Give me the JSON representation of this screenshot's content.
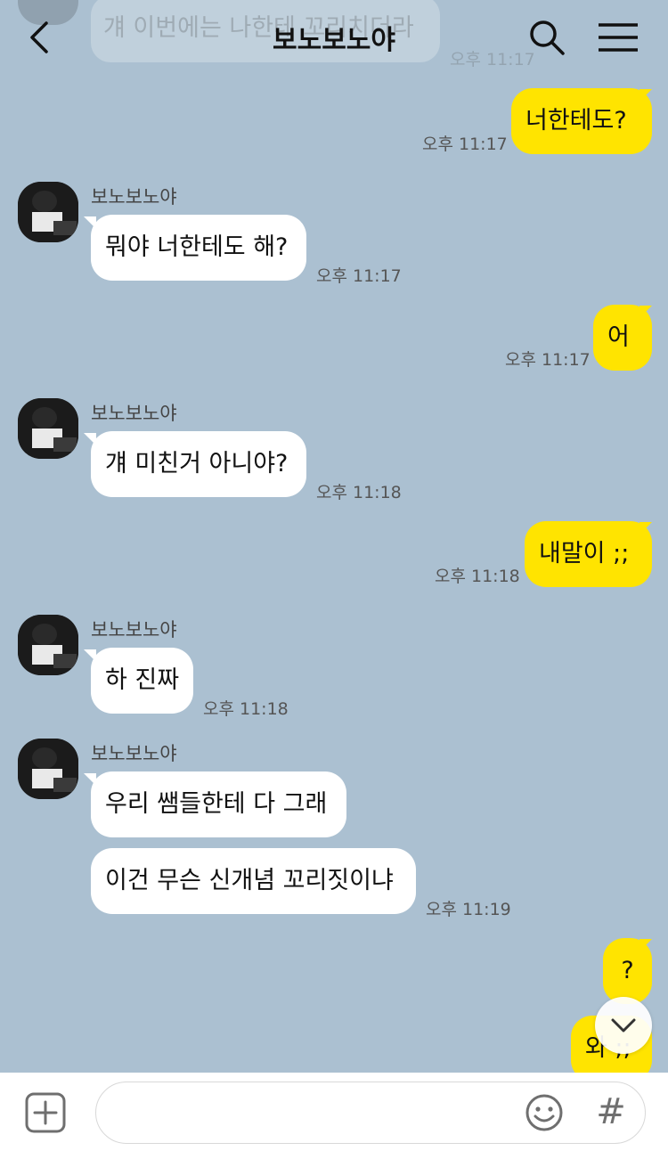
{
  "header": {
    "back_icon": "chevron-left-icon",
    "title": "보노보노야",
    "search_icon": "search-icon",
    "menu_icon": "hamburger-menu-icon"
  },
  "faded_top": {
    "text": "걔 이번에는 나한테 꼬리치더라",
    "time": "오후 11:17"
  },
  "messages": [
    {
      "side": "out",
      "text": "너한테도?",
      "time": "오후 11:17"
    },
    {
      "side": "in",
      "sender": "보노보노야",
      "text": "뭐야 너한테도 해?",
      "time": "오후 11:17"
    },
    {
      "side": "out",
      "text": "어",
      "time": "오후 11:17"
    },
    {
      "side": "in",
      "sender": "보노보노야",
      "text": "걔 미친거 아니야?",
      "time": "오후 11:18"
    },
    {
      "side": "out",
      "text": "내말이 ;;",
      "time": "오후 11:18"
    },
    {
      "side": "in",
      "sender": "보노보노야",
      "text": "하 진짜",
      "time": "오후 11:18"
    },
    {
      "side": "in",
      "sender": "보노보노야",
      "text": "우리 쌤들한테 다 그래",
      "time": ""
    },
    {
      "side": "in",
      "text": "이건 무슨 신개념 꼬리짓이냐",
      "time": "오후 11:19"
    },
    {
      "side": "out",
      "text": "?",
      "time": ""
    },
    {
      "side": "out",
      "text": "와 ;;",
      "time": ""
    }
  ],
  "scroll_down_icon": "chevron-down-icon",
  "composer": {
    "plus_icon": "plus-square-icon",
    "placeholder": "",
    "emoji_icon": "smiley-icon",
    "hash_label": "#"
  },
  "colors": {
    "background": "#abc0d1",
    "outgoing_bubble": "#ffe400",
    "incoming_bubble": "#ffffff"
  }
}
